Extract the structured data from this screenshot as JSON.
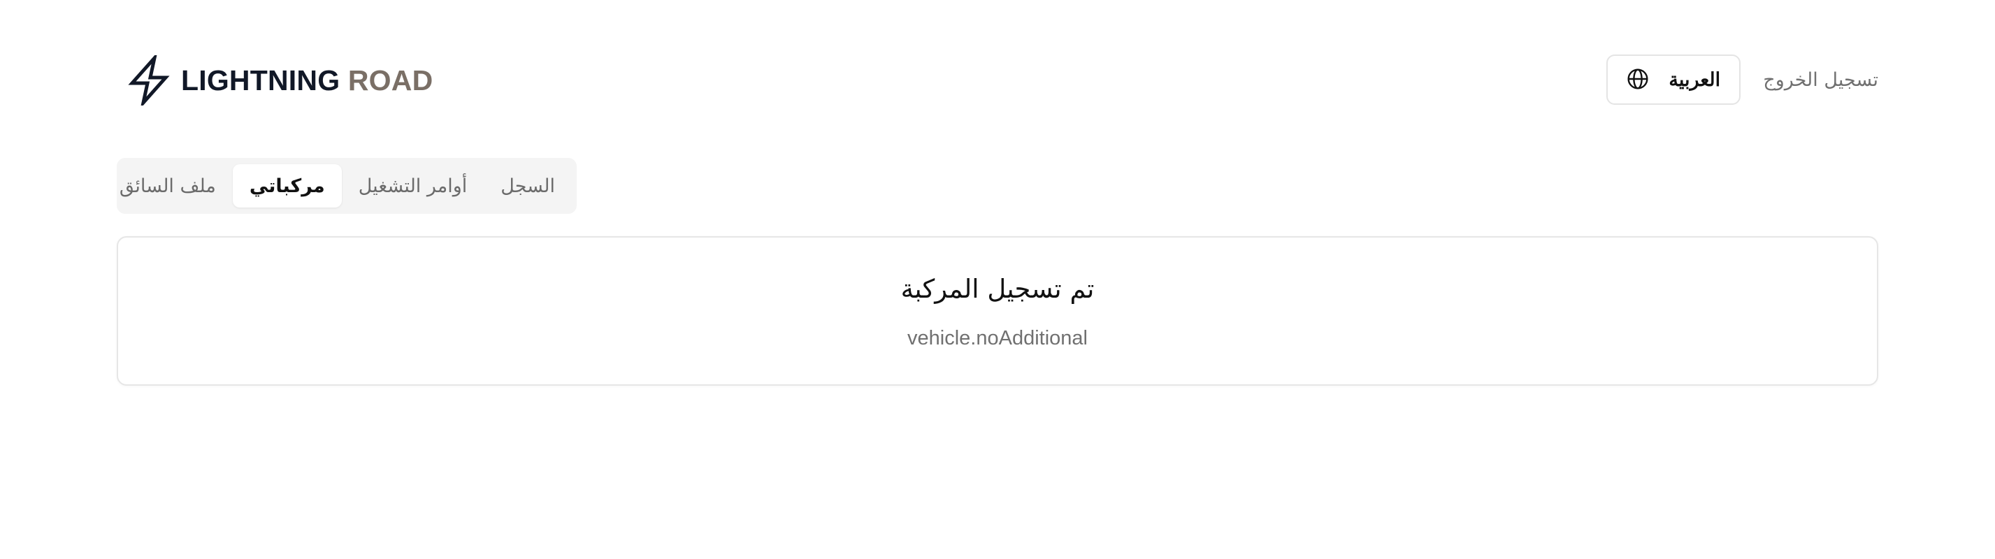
{
  "header": {
    "brand": {
      "word1": "LIGHTNING",
      "word2": "ROAD",
      "icon": "lightning-bolt-icon"
    },
    "language_button": {
      "label": "العربية",
      "icon": "globe-icon"
    },
    "logout_label": "تسجيل الخروج"
  },
  "tabs": [
    {
      "label": "السجل",
      "active": false
    },
    {
      "label": "أوامر التشغيل",
      "active": false
    },
    {
      "label": "مركباتي",
      "active": true
    },
    {
      "label": "ملف السائق",
      "active": false
    }
  ],
  "card": {
    "title": "تم تسجيل المركبة",
    "subtitle": "vehicle.noAdditional"
  },
  "colors": {
    "brand_dark": "#111827",
    "brand_accent": "#7a6f66",
    "muted_text": "#707070",
    "tab_bar_bg": "#f4f4f4",
    "border": "#e4e4e4"
  }
}
